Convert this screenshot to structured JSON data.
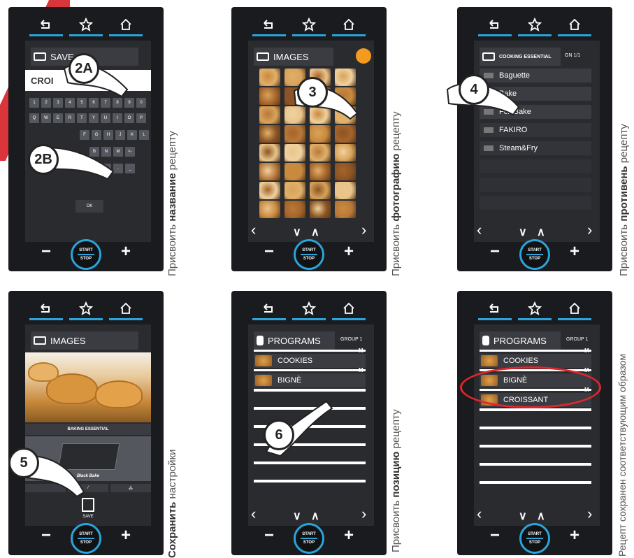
{
  "colors": {
    "accent": "#2ba4dc",
    "device": "#1a1b1e",
    "screen": "#2a2b2f",
    "highlight": "#e0262b"
  },
  "common": {
    "start": "START",
    "stop": "STOP",
    "minus": "−",
    "plus": "+"
  },
  "panel1": {
    "header": "SAVE",
    "input_value": "CROI",
    "keys_row1": [
      "1",
      "2",
      "3",
      "4",
      "5",
      "6",
      "7",
      "8",
      "9",
      "0"
    ],
    "keys_row2": [
      "Q",
      "W",
      "E",
      "R",
      "T",
      "Y",
      "U",
      "I",
      "O",
      "P"
    ],
    "keys_row3": [
      "F",
      "G",
      "H",
      "J",
      "K",
      "L"
    ],
    "keys_row4": [
      "B",
      "N",
      "M",
      "<-"
    ],
    "ok_label": "OK",
    "step_a": "2A",
    "step_b": "2B",
    "caption_normal": "Присвоить ",
    "caption_bold": "название",
    "caption_tail": " рецепту"
  },
  "panel2": {
    "header": "IMAGES",
    "step": "3",
    "caption_normal": "Присвоить ",
    "caption_bold": "фотографию",
    "caption_tail": " рецепту"
  },
  "panel3": {
    "header": "COOKING ESSENTIAL",
    "gn": "GN 1/1",
    "items": [
      "Baguette",
      "Bake",
      "Fck.Bake",
      "FAKIRO",
      "Steam&Fry"
    ],
    "step": "4",
    "caption_normal": "Присвоить ",
    "caption_bold": "противень",
    "caption_tail": " рецепту"
  },
  "panel4": {
    "header": "IMAGES",
    "baking_label": "BAKING ESSENTIAL",
    "tray_label": "Black Bake",
    "save_label": "SAVE",
    "step": "5",
    "caption_bold": "Сохранить",
    "caption_tail": " настройки"
  },
  "panel5": {
    "header": "PROGRAMS",
    "group": "GROUP 1",
    "items": [
      "COOKIES",
      "BIGNÈ"
    ],
    "tag": "M",
    "step": "6",
    "caption_normal": "Присвоить ",
    "caption_bold": "позицию",
    "caption_tail": " рецепту"
  },
  "panel6": {
    "header": "PROGRAMS",
    "group": "GROUP 1",
    "items": [
      "COOKIES",
      "BIGNÈ",
      "CROISSANT"
    ],
    "tag": "M",
    "caption": "Рецепт сохранен соответствующим образом"
  }
}
